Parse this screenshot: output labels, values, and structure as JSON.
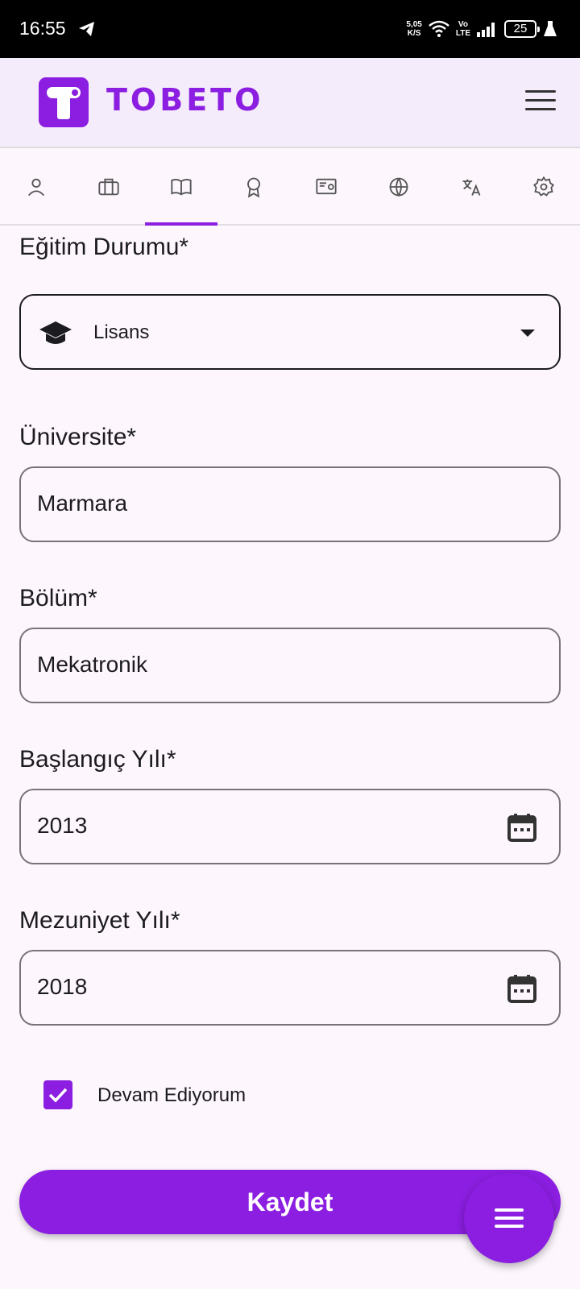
{
  "status_bar": {
    "time": "16:55",
    "net_speed_value": "5,05",
    "net_speed_unit": "K/S",
    "volte_top": "Vo",
    "volte_bottom": "LTE",
    "battery": "25",
    "icons": [
      "telegram-icon",
      "wifi-icon",
      "signal-icon",
      "battery-icon",
      "flask-icon"
    ]
  },
  "app_bar": {
    "brand": "TOBETO",
    "brand_color": "#8b1ee0"
  },
  "tabs": [
    {
      "icon": "person-icon"
    },
    {
      "icon": "briefcase-icon"
    },
    {
      "icon": "book-icon",
      "active": true
    },
    {
      "icon": "award-icon"
    },
    {
      "icon": "certificate-icon"
    },
    {
      "icon": "globe-icon"
    },
    {
      "icon": "translate-icon"
    },
    {
      "icon": "settings-icon"
    }
  ],
  "form": {
    "education_label": "Eğitim Durumu*",
    "education_value": "Lisans",
    "university_label": "Üniversite*",
    "university_value": "Marmara",
    "department_label": "Bölüm*",
    "department_value": "Mekatronik",
    "start_label": "Başlangıç Yılı*",
    "start_value": "2013",
    "grad_label": "Mezuniyet Yılı*",
    "grad_value": "2018",
    "continuing_label": "Devam Ediyorum",
    "continuing_checked": true
  },
  "actions": {
    "save_label": "Kaydet"
  }
}
